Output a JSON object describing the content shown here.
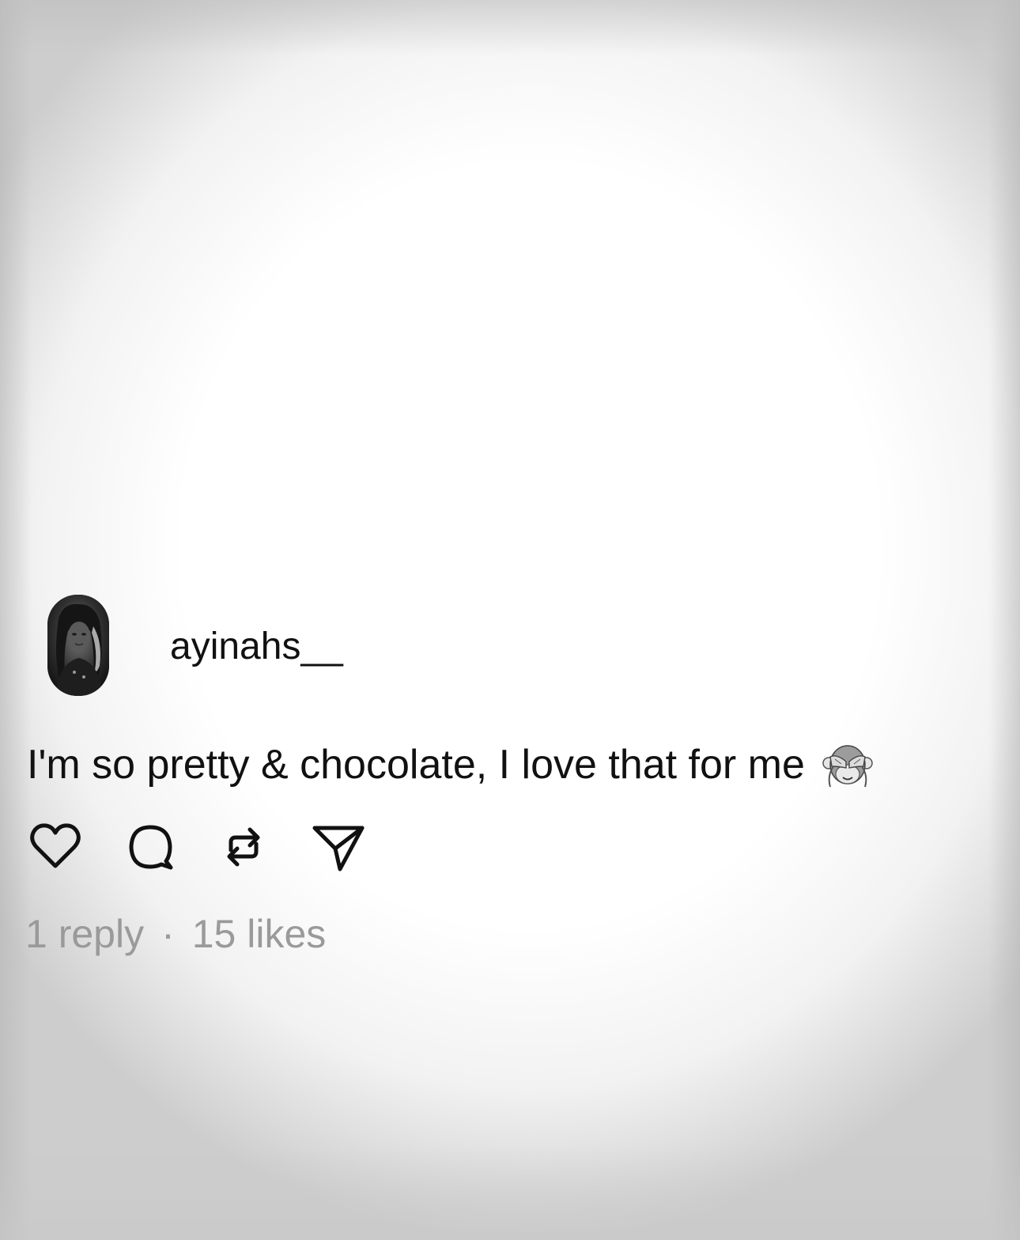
{
  "post": {
    "username": "ayinahs__",
    "avatar_icon": "profile-photo",
    "text": "I'm so pretty & chocolate, I love that for me",
    "emoji_icon": "see-no-evil-monkey-emoji",
    "actions": [
      {
        "icon": "heart-icon"
      },
      {
        "icon": "comment-icon"
      },
      {
        "icon": "repost-icon"
      },
      {
        "icon": "share-icon"
      }
    ],
    "replies": "1 reply",
    "separator": "·",
    "likes": "15 likes"
  },
  "colors": {
    "text": "#111111",
    "muted": "#9a9a9a",
    "background": "#ffffff"
  }
}
